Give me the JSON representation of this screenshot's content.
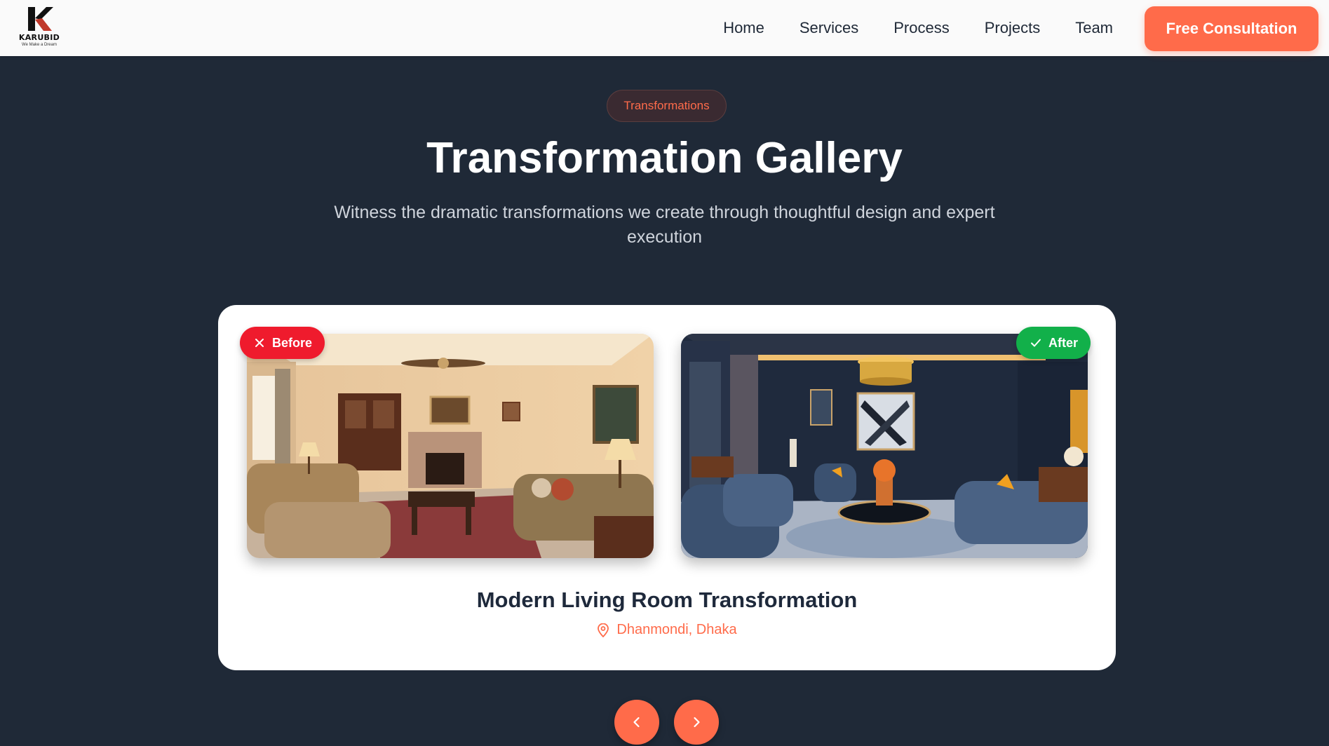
{
  "brand": {
    "name": "KARUBID",
    "tagline": "We Make a Dream"
  },
  "nav": {
    "items": [
      {
        "label": "Home"
      },
      {
        "label": "Services"
      },
      {
        "label": "Process"
      },
      {
        "label": "Projects"
      },
      {
        "label": "Team"
      }
    ],
    "cta_label": "Free Consultation"
  },
  "section": {
    "pill": "Transformations",
    "title": "Transformation Gallery",
    "subtitle": "Witness the dramatic transformations we create through thoughtful design and expert execution"
  },
  "gallery": {
    "before_label": "Before",
    "after_label": "After",
    "project_title": "Modern Living Room Transformation",
    "location": "Dhanmondi, Dhaka",
    "icons": {
      "before": "close-icon",
      "after": "check-icon",
      "location": "map-pin-icon",
      "prev": "chevron-left-icon",
      "next": "chevron-right-icon"
    }
  },
  "colors": {
    "background": "#1f2937",
    "accent": "#ff6b4a",
    "before_badge": "#ef1b2d",
    "after_badge": "#12b04a",
    "card": "#ffffff"
  }
}
